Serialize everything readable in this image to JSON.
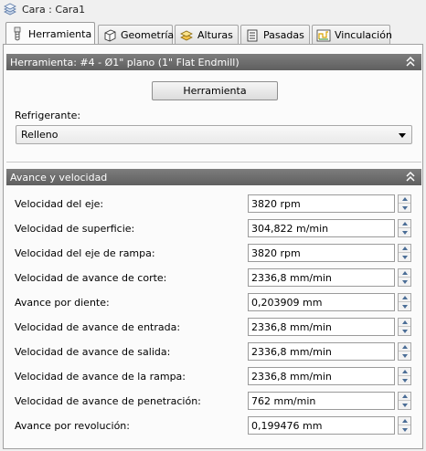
{
  "window": {
    "title": "Cara : Cara1"
  },
  "tabs": [
    {
      "label": "Herramienta",
      "icon": "tool-icon",
      "active": true
    },
    {
      "label": "Geometría",
      "icon": "cube-icon",
      "active": false
    },
    {
      "label": "Alturas",
      "icon": "heights-icon",
      "active": false
    },
    {
      "label": "Pasadas",
      "icon": "passes-icon",
      "active": false
    },
    {
      "label": "Vinculación",
      "icon": "linking-icon",
      "active": false
    }
  ],
  "tool_section": {
    "header": "Herramienta: #4 - Ø1\" plano (1\" Flat Endmill)",
    "tool_button": "Herramienta",
    "coolant_label": "Refrigerante:",
    "coolant_value": "Relleno"
  },
  "feed_section": {
    "header": "Avance y velocidad",
    "rows": [
      {
        "label": "Velocidad del eje:",
        "value": "3820 rpm"
      },
      {
        "label": "Velocidad de superficie:",
        "value": "304,822 m/min"
      },
      {
        "label": "Velocidad del eje de rampa:",
        "value": "3820 rpm"
      },
      {
        "label": "Velocidad de avance de corte:",
        "value": "2336,8 mm/min"
      },
      {
        "label": "Avance por diente:",
        "value": "0,203909 mm"
      },
      {
        "label": "Velocidad de avance de entrada:",
        "value": "2336,8 mm/min"
      },
      {
        "label": "Velocidad de avance de salida:",
        "value": "2336,8 mm/min"
      },
      {
        "label": "Velocidad de avance de la rampa:",
        "value": "2336,8 mm/min"
      },
      {
        "label": "Velocidad de avance de penetración:",
        "value": "762 mm/min"
      },
      {
        "label": "Avance por revolución:",
        "value": "0,199476 mm"
      }
    ]
  },
  "colors": {
    "section_header": "#6e6e6e",
    "spinner_arrow": "#4a6d96",
    "panel_bg": "#fbfbfb"
  }
}
